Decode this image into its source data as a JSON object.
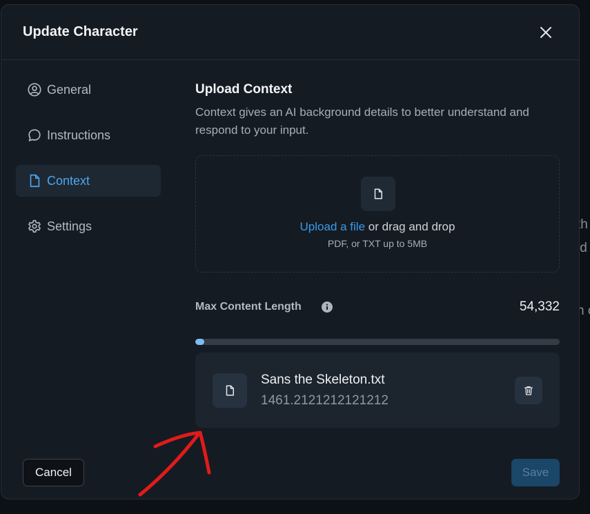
{
  "background_fragments": [
    "th",
    "id",
    "n c"
  ],
  "dialog": {
    "title": "Update Character",
    "close_icon": "close-icon"
  },
  "sidebar": {
    "items": [
      {
        "label": "General",
        "icon": "user-circle-icon",
        "active": false
      },
      {
        "label": "Instructions",
        "icon": "chat-bubble-icon",
        "active": false
      },
      {
        "label": "Context",
        "icon": "document-icon",
        "active": true
      },
      {
        "label": "Settings",
        "icon": "gear-icon",
        "active": false
      }
    ]
  },
  "context": {
    "title": "Upload Context",
    "description": "Context gives an AI background details to better understand and respond to your input.",
    "dropzone": {
      "link_text": "Upload a file",
      "rest_text": " or drag and drop",
      "hint": "PDF, or TXT up to 5MB"
    },
    "max_length": {
      "label": "Max Content Length",
      "value": "54,332",
      "usage_fraction": 0.013
    },
    "file": {
      "name": "Sans the Skeleton.txt",
      "size": "1461.2121212121212"
    }
  },
  "footer": {
    "cancel_label": "Cancel",
    "save_label": "Save"
  },
  "colors": {
    "accent": "#3a9ae8",
    "active_nav_bg": "#1e2833",
    "save_disabled_bg": "#1a4668",
    "annotation_arrow": "#e01b1b"
  }
}
